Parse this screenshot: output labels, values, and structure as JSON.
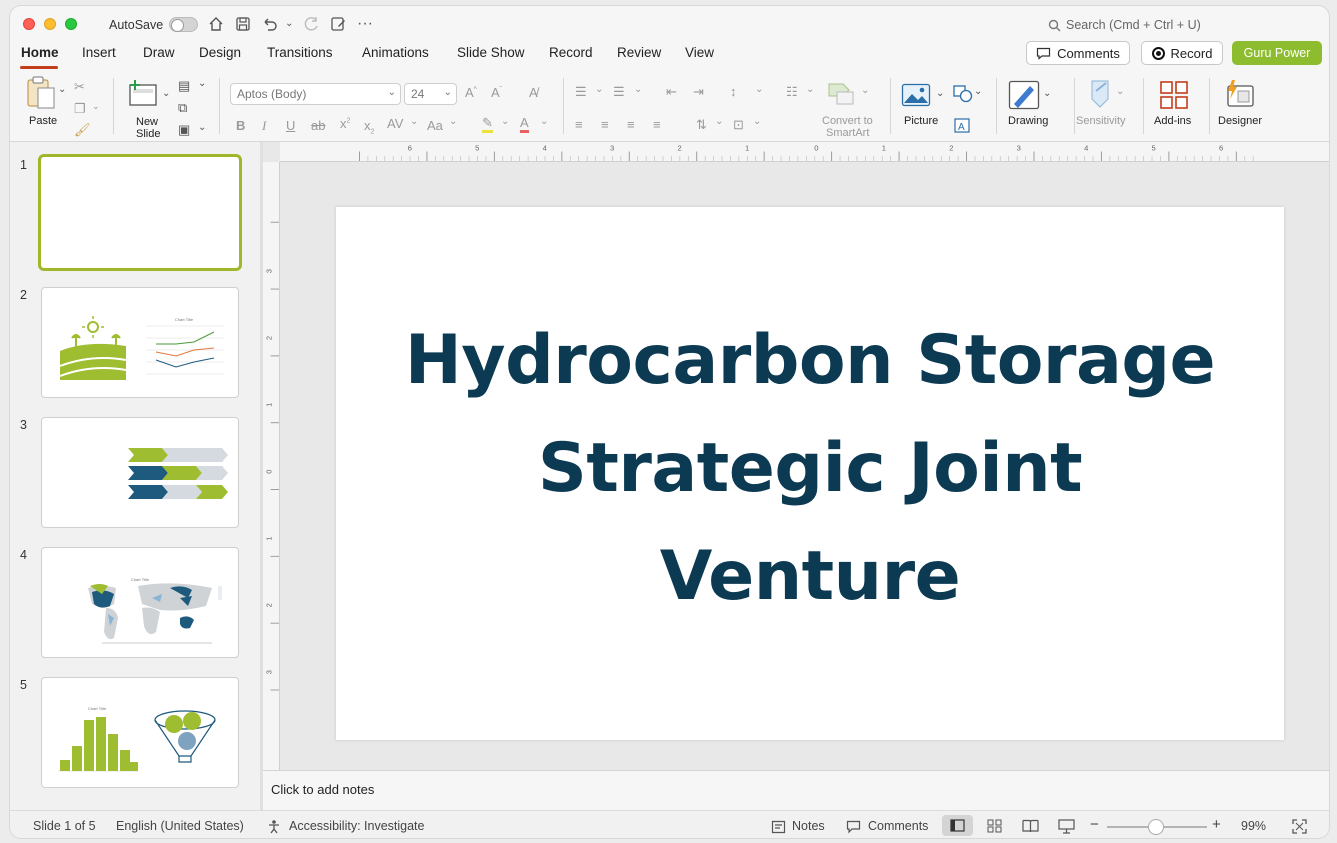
{
  "titlebar": {
    "autosave_label": "AutoSave",
    "search_placeholder": "Search (Cmd + Ctrl + U)"
  },
  "tabs": [
    {
      "label": "Home"
    },
    {
      "label": "Insert"
    },
    {
      "label": "Draw"
    },
    {
      "label": "Design"
    },
    {
      "label": "Transitions"
    },
    {
      "label": "Animations"
    },
    {
      "label": "Slide Show"
    },
    {
      "label": "Record"
    },
    {
      "label": "Review"
    },
    {
      "label": "View"
    }
  ],
  "actions": {
    "comments_label": "Comments",
    "record_label": "Record",
    "guru_label": "Guru Power"
  },
  "ribbon": {
    "paste_label": "Paste",
    "new_slide_label_1": "New",
    "new_slide_label_2": "Slide",
    "font_name": "Aptos (Body)",
    "font_size": "24",
    "convert_label_1": "Convert to",
    "convert_label_2": "SmartArt",
    "picture_label": "Picture",
    "drawing_label": "Drawing",
    "sensitivity_label": "Sensitivity",
    "addins_label": "Add-ins",
    "designer_label": "Designer"
  },
  "thumbnails": [
    {
      "number": "1"
    },
    {
      "number": "2",
      "chart_title": "Chart Title"
    },
    {
      "number": "3"
    },
    {
      "number": "4",
      "chart_title": "Chart Title"
    },
    {
      "number": "5",
      "chart_title": "Chart Title"
    }
  ],
  "slide": {
    "title_line1": "Hydrocarbon Storage",
    "title_line2": "Strategic Joint",
    "title_line3": "Venture"
  },
  "ruler": {
    "h_labels": [
      "6",
      "5",
      "4",
      "3",
      "2",
      "1",
      "0",
      "1",
      "2",
      "3",
      "4",
      "5",
      "6"
    ],
    "v_labels": [
      "3",
      "2",
      "1",
      "0",
      "1",
      "2",
      "3"
    ]
  },
  "notes": {
    "placeholder": "Click to add notes"
  },
  "status": {
    "slide_count": "Slide 1 of 5",
    "language": "English (United States)",
    "accessibility": "Accessibility: Investigate",
    "notes_label": "Notes",
    "comments_label": "Comments",
    "zoom": "99%"
  },
  "colors": {
    "title_text": "#0b3a52",
    "accent_green": "#8dbd2f",
    "active_tab_underline": "#c43e1c",
    "navy": "#1e5a7e"
  }
}
